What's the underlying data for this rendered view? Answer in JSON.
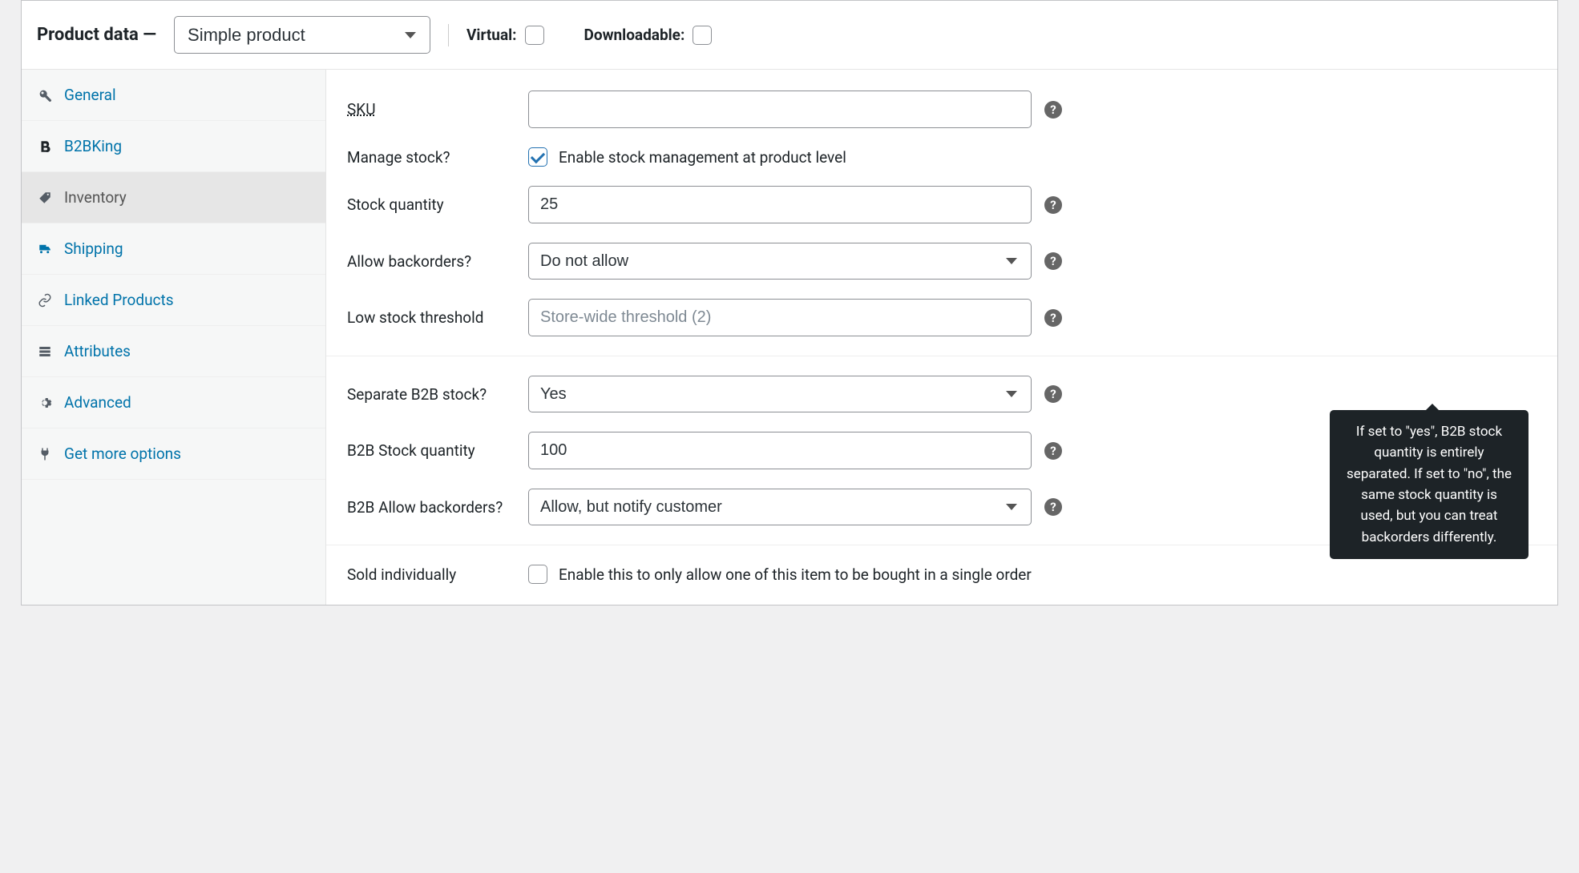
{
  "header": {
    "title": "Product data —",
    "product_type": "Simple product",
    "virtual_label": "Virtual:",
    "virtual_checked": false,
    "downloadable_label": "Downloadable:",
    "downloadable_checked": false
  },
  "tabs": [
    {
      "id": "general",
      "label": "General",
      "icon": "wrench"
    },
    {
      "id": "b2bking",
      "label": "B2BKing",
      "icon": "b-bold"
    },
    {
      "id": "inventory",
      "label": "Inventory",
      "icon": "tag"
    },
    {
      "id": "shipping",
      "label": "Shipping",
      "icon": "truck"
    },
    {
      "id": "linked",
      "label": "Linked Products",
      "icon": "link"
    },
    {
      "id": "attributes",
      "label": "Attributes",
      "icon": "list"
    },
    {
      "id": "advanced",
      "label": "Advanced",
      "icon": "gear"
    },
    {
      "id": "getmore",
      "label": "Get more options",
      "icon": "plug"
    }
  ],
  "active_tab": "inventory",
  "fields": {
    "sku": {
      "label": "SKU",
      "value": ""
    },
    "manage_stock": {
      "label": "Manage stock?",
      "desc": "Enable stock management at product level",
      "checked": true
    },
    "stock_qty": {
      "label": "Stock quantity",
      "value": "25"
    },
    "backorders": {
      "label": "Allow backorders?",
      "value": "Do not allow"
    },
    "low_stock": {
      "label": "Low stock threshold",
      "placeholder": "Store-wide threshold (2)",
      "value": ""
    },
    "sep_b2b": {
      "label": "Separate B2B stock?",
      "value": "Yes"
    },
    "b2b_qty": {
      "label": "B2B Stock quantity",
      "value": "100"
    },
    "b2b_backorders": {
      "label": "B2B Allow backorders?",
      "value": "Allow, but notify customer"
    },
    "sold_individually": {
      "label": "Sold individually",
      "desc": "Enable this to only allow one of this item to be bought in a single order",
      "checked": false
    }
  },
  "tooltip": {
    "text": "If set to \"yes\", B2B stock quantity is entirely separated. If set to \"no\", the same stock quantity is used, but you can treat backorders differently."
  },
  "help_glyph": "?"
}
